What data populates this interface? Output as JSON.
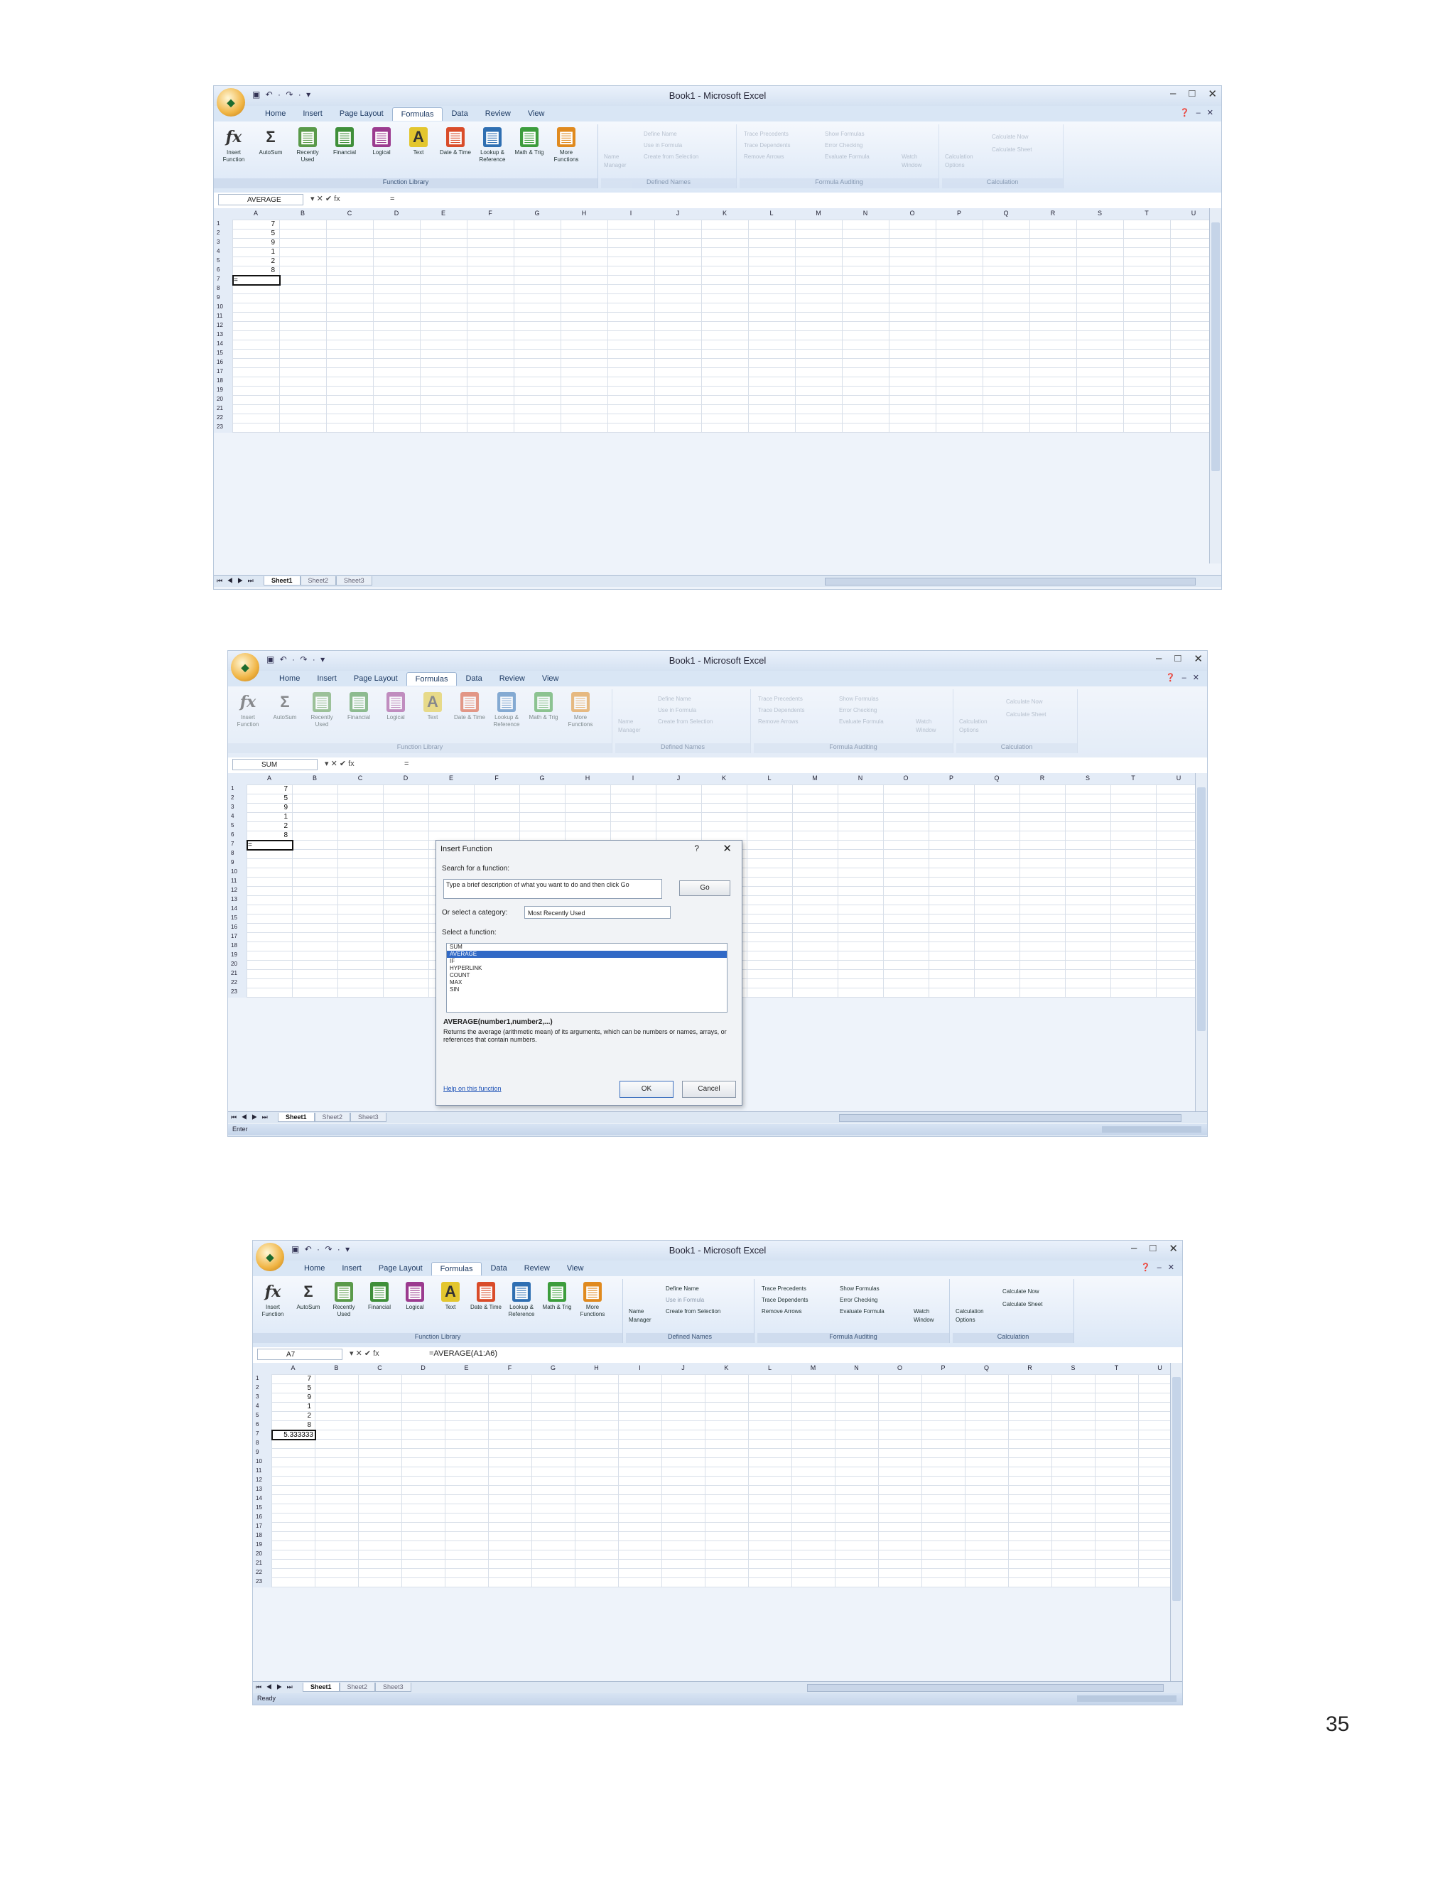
{
  "page_number": "35",
  "common": {
    "window_title": "Book1 - Microsoft Excel",
    "office_button": "Office",
    "qat": "▣ ↶ · ↷ · ▾",
    "win_controls": [
      "–",
      "□",
      "✕"
    ],
    "tabs": [
      "Home",
      "Insert",
      "Page Layout",
      "Formulas",
      "Data",
      "Review",
      "View"
    ],
    "active_tab": "Formulas",
    "ribbon_buttons": [
      {
        "label": "Insert Function",
        "icon": "fx",
        "color": "#ffffff"
      },
      {
        "label": "AutoSum",
        "icon": "Σ",
        "color": "#ffffff"
      },
      {
        "label": "Recently Used",
        "icon": "▤",
        "color": "#5a9a4a"
      },
      {
        "label": "Financial",
        "icon": "▤",
        "color": "#3f8f3a"
      },
      {
        "label": "Logical",
        "icon": "▤",
        "color": "#9b3b8f"
      },
      {
        "label": "Text",
        "icon": "A",
        "color": "#e3c62e"
      },
      {
        "label": "Date & Time",
        "icon": "▤",
        "color": "#d94c2a"
      },
      {
        "label": "Lookup & Reference",
        "icon": "▤",
        "color": "#2f6fb2"
      },
      {
        "label": "Math & Trig",
        "icon": "▤",
        "color": "#3d9d3d"
      },
      {
        "label": "More Functions",
        "icon": "▤",
        "color": "#e08a1f"
      }
    ],
    "group_labels": [
      "Function Library",
      "Defined Names",
      "Formula Auditing",
      "Calculation"
    ],
    "defined_names": [
      "Name Manager",
      "Define Name",
      "Use in Formula",
      "Create from Selection"
    ],
    "auditing": [
      "Trace Precedents",
      "Trace Dependents",
      "Remove Arrows",
      "Show Formulas",
      "Error Checking",
      "Evaluate Formula",
      "Watch Window"
    ],
    "calculation": [
      "Calculation Options",
      "Calculate Now",
      "Calculate Sheet"
    ],
    "columns": [
      "A",
      "B",
      "C",
      "D",
      "E",
      "F",
      "G",
      "H",
      "I",
      "J",
      "K",
      "L",
      "M",
      "N",
      "O",
      "P",
      "Q",
      "R",
      "S",
      "T",
      "U"
    ],
    "rows": [
      "1",
      "2",
      "3",
      "4",
      "5",
      "6",
      "7",
      "8",
      "9",
      "10",
      "11",
      "12",
      "13",
      "14",
      "15",
      "16",
      "17",
      "18",
      "19",
      "20",
      "21",
      "22",
      "23"
    ],
    "values": [
      "7",
      "5",
      "9",
      "1",
      "2",
      "8"
    ],
    "sheet_nav": "⏮ ◀ ▶ ⏭",
    "sheets": [
      "Sheet1",
      "Sheet2",
      "Sheet3"
    ],
    "fbar_buttons": "▾  ✕ ✔ fx"
  },
  "shot1": {
    "name_box": "AVERAGE",
    "formula": "=",
    "active_value": "=",
    "status": ""
  },
  "shot2": {
    "name_box": "SUM",
    "formula": "=",
    "active_value": "=",
    "status": "Enter",
    "dialog": {
      "title": "Insert Function",
      "help_glyph": "?",
      "close_glyph": "✕",
      "search_label": "Search for a function:",
      "search_text": "Type a brief description of what you want to do and then click Go",
      "go": "Go",
      "category_label": "Or select a category:",
      "category_value": "Most Recently Used",
      "function_label": "Select a function:",
      "functions": [
        "SUM",
        "AVERAGE",
        "IF",
        "HYPERLINK",
        "COUNT",
        "MAX",
        "SIN"
      ],
      "selected": "AVERAGE",
      "signature": "AVERAGE(number1,number2,...)",
      "description": "Returns the average (arithmetic mean) of its arguments, which can be numbers or names, arrays, or references that contain numbers.",
      "help_link": "Help on this function",
      "ok": "OK",
      "cancel": "Cancel"
    }
  },
  "shot3": {
    "name_box": "A7",
    "formula": "=AVERAGE(A1:A6)",
    "active_value": "5.333333",
    "status": "Ready"
  }
}
